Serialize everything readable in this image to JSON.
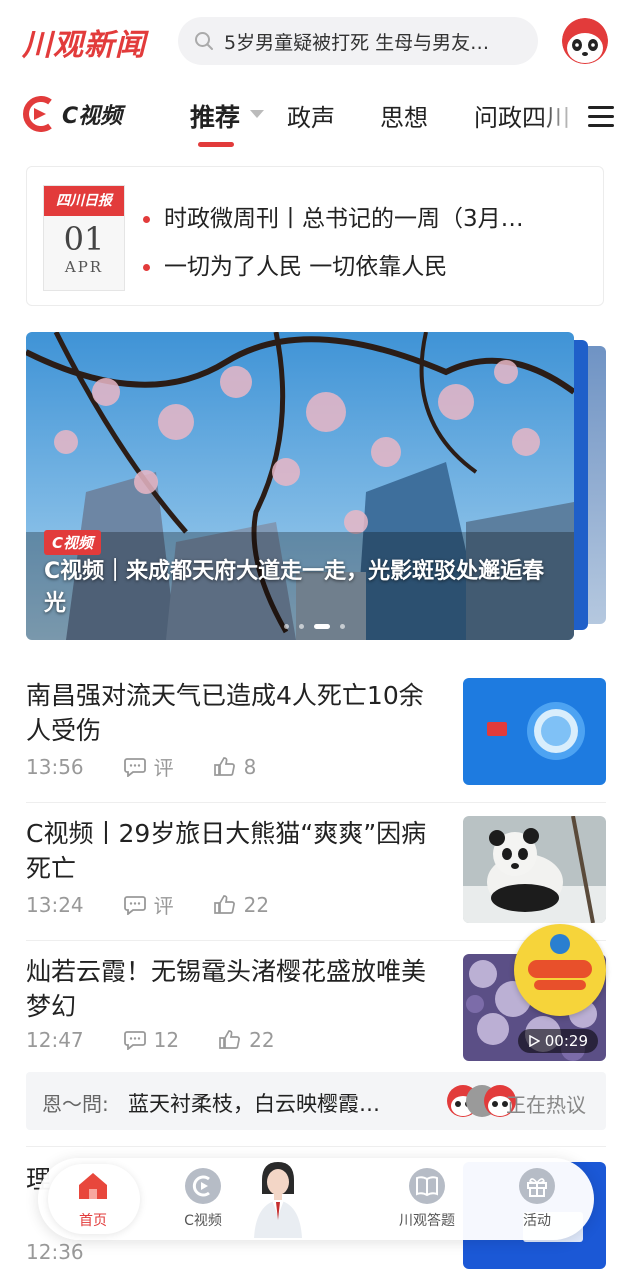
{
  "header": {
    "logo_text": "川观新闻",
    "search_placeholder": "5岁男童疑被打死  生母与男友…"
  },
  "tabs": {
    "cvideo_logo_text": "C视频",
    "items": [
      {
        "label": "推荐",
        "active": true
      },
      {
        "label": "政声"
      },
      {
        "label": "思想"
      },
      {
        "label": "问政四川"
      }
    ]
  },
  "paper": {
    "masthead": "四川日报",
    "day": "01",
    "month": "APR",
    "lines": [
      "时政微周刊丨总书记的一周（3月…",
      "一切为了人民  一切依靠人民"
    ]
  },
  "carousel": {
    "badge": "C视频",
    "title": "C视频｜来成都天府大道走一走，光影斑驳处邂逅春光"
  },
  "news": [
    {
      "title": "南昌强对流天气已造成4人死亡10余人受伤",
      "time": "13:56",
      "comments": "评",
      "likes": "8"
    },
    {
      "title": "C视频丨29岁旅日大熊猫“爽爽”因病死亡",
      "time": "13:24",
      "comments": "评",
      "likes": "22"
    },
    {
      "title": "灿若云霞！无锡鼋头渚樱花盛放唯美梦幻",
      "time": "12:47",
      "comments": "12",
      "likes": "22",
      "duration": "00:29"
    },
    {
      "title": "理",
      "time": "12:36"
    }
  ],
  "hot": {
    "user": "恩～問:",
    "text": "蓝天衬柔枝，白云映樱霞…",
    "status": "正在热议"
  },
  "bottom_nav": [
    {
      "label": "首页",
      "active": true
    },
    {
      "label": "C视频"
    },
    {
      "label": "川观答题"
    },
    {
      "label": "活动"
    }
  ],
  "colors": {
    "accent": "#e23b3b",
    "meta": "#999999"
  }
}
